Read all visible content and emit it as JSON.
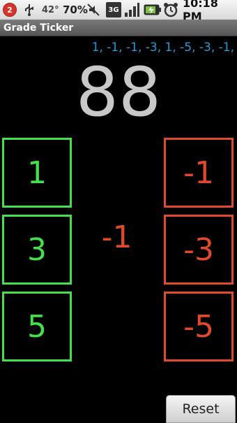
{
  "status_bar": {
    "notification_count": "2",
    "temperature": "42°",
    "battery_percent": "70%",
    "network": "3G",
    "time": "10:18 PM"
  },
  "app": {
    "title": "Grade Ticker"
  },
  "history": "1, -1, -1, -3, 1, -5, -3, -1,",
  "total": "88",
  "last_change": "-1",
  "buttons": {
    "plus": [
      "1",
      "3",
      "5"
    ],
    "minus": [
      "-1",
      "-3",
      "-5"
    ],
    "reset": "Reset"
  },
  "colors": {
    "plus": "#44e04a",
    "minus": "#e04a2a",
    "history": "#1e9cd7"
  }
}
